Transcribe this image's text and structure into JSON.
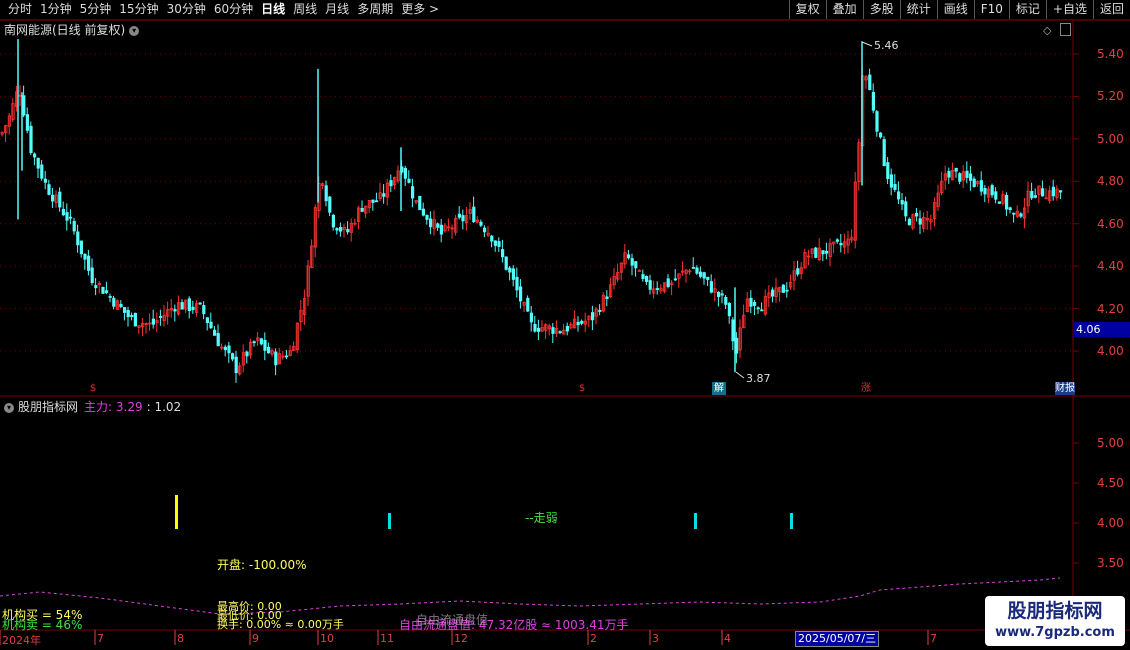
{
  "toolbar": {
    "periods": [
      "分时",
      "1分钟",
      "5分钟",
      "15分钟",
      "30分钟",
      "60分钟",
      "日线",
      "周线",
      "月线",
      "多周期",
      "更多 >"
    ],
    "active_period": "日线",
    "actions": [
      "复权",
      "叠加",
      "多股",
      "统计",
      "画线",
      "F10",
      "标记",
      "+自选",
      "返回"
    ]
  },
  "main_chart": {
    "title": "南网能源(日线 前复权)",
    "price_labels": [
      "5.40",
      "5.20",
      "5.00",
      "4.80",
      "4.60",
      "4.40",
      "4.20",
      "4.00"
    ],
    "current_price": "4.06",
    "high_label": "5.46",
    "low_label": "3.87",
    "event_badges": [
      {
        "text": "$",
        "color": "#e03030"
      },
      {
        "text": "$",
        "color": "#e03030"
      },
      {
        "text": "解",
        "color": "#40c0e0"
      },
      {
        "text": "涨",
        "color": "#e03030"
      },
      {
        "text": "财报",
        "color": "#40a0ff"
      }
    ]
  },
  "sub_chart": {
    "title": "股朋指标网",
    "zhuli_label": "主力: 3.29",
    "second_value": ": 1.02",
    "value_labels": [
      "5.00",
      "4.50",
      "4.00",
      "3.50"
    ],
    "signal_text": "--走弱",
    "open_text": "开盘: -100.00%",
    "buy_text": "机构买 = 54%",
    "sell_text": "机构卖 = 46%",
    "high_price": "最高价: 0.00",
    "low_price": "最低价: 0.00",
    "turnover": "换手: 0.00% ≈ 0.00万手",
    "float_value": "自由流通盘值: 47.32亿股 ≈ 1003.41万手",
    "float_overlay": "自由流通盘值"
  },
  "date_axis": {
    "labels": [
      "2024年",
      "7",
      "8",
      "9",
      "10",
      "11",
      "12",
      "2",
      "3",
      "4",
      "7"
    ],
    "selected_date": "2025/05/07/三"
  },
  "watermark": {
    "name": "股朋指标网",
    "url": "www.7gpzb.com"
  },
  "colors": {
    "up": "#ff3232",
    "down": "#54fcfc",
    "grid": "#7a0000",
    "signal_yellow": "#ffff00",
    "signal_cyan": "#00e0e0",
    "dashed_line": "#e040e0"
  }
}
